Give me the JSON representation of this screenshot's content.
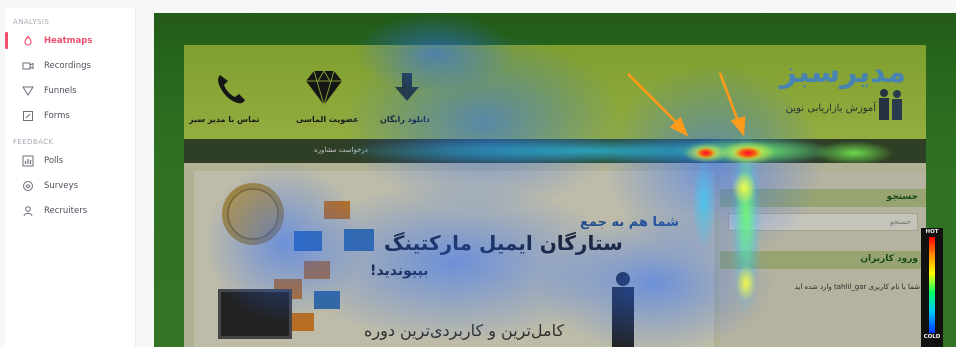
{
  "sidebar": {
    "sections": [
      {
        "label": "ANALYSIS",
        "items": [
          {
            "label": "Heatmaps",
            "icon": "flame-icon",
            "active": true
          },
          {
            "label": "Recordings",
            "icon": "recording-icon",
            "active": false
          },
          {
            "label": "Funnels",
            "icon": "funnel-icon",
            "active": false
          },
          {
            "label": "Forms",
            "icon": "form-icon",
            "active": false
          }
        ]
      },
      {
        "label": "FEEDBACK",
        "items": [
          {
            "label": "Polls",
            "icon": "poll-icon",
            "active": false
          },
          {
            "label": "Surveys",
            "icon": "survey-icon",
            "active": false
          },
          {
            "label": "Recruiters",
            "icon": "recruiter-icon",
            "active": false
          }
        ]
      }
    ]
  },
  "site": {
    "logo": "مدیرسبز",
    "logo_sub": "آموزش بازاریابی نوین",
    "header_links": [
      "دانلود رایگان",
      "عضویت الماسی",
      "تماس با مدیر سبز"
    ],
    "nav": "درخواست مشاوره",
    "search_title": "جستجو",
    "search_placeholder": "جستجو",
    "login_title": "ورود کاربران",
    "login_text": "شما با نام کاربری tahlil_gar وارد شده اید",
    "promo_line1": "شما هم به جمع",
    "promo_line2": "ستارگان ایمیل مارکتینگ",
    "promo_line3": "بپیوندید!",
    "promo_line4": "کامل‌ترین و کاربردی‌ترین دوره"
  },
  "legend": {
    "hot": "HOT",
    "cold": "COLD"
  },
  "colors": {
    "accent": "#f0506e",
    "site_green": "#3e8e2d"
  }
}
